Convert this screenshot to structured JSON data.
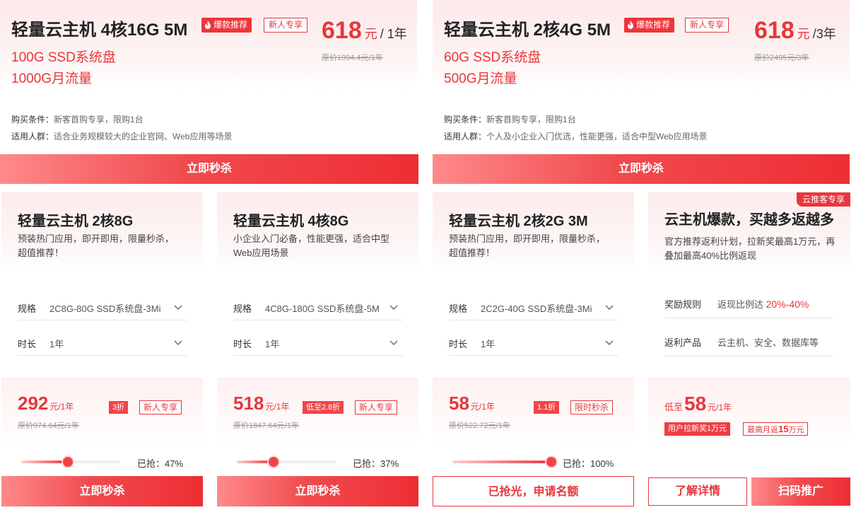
{
  "colors": {
    "accent": "#e8363c",
    "text": "#333333",
    "muted": "#999999"
  },
  "top_cards": [
    {
      "title": "轻量云主机 4核16G 5M",
      "hot_tag": "爆款推荐",
      "new_tag": "新人专享",
      "disk": "100G SSD系统盘",
      "traffic": "1000G月流量",
      "price": "618",
      "price_unit": "元",
      "price_period": "/ 1年",
      "original_price": "原价1994.4元/1年",
      "condition_label": "购买条件：",
      "condition_value": "新客首购专享，限购1台",
      "audience_label": "适用人群：",
      "audience_value": "适合业务规模较大的企业官网、Web应用等场景",
      "button": "立即秒杀"
    },
    {
      "title": "轻量云主机 2核4G 5M",
      "hot_tag": "爆款推荐",
      "new_tag": "新人专享",
      "disk": "60G SSD系统盘",
      "traffic": "500G月流量",
      "price": "618",
      "price_unit": "元",
      "price_period": "/3年",
      "original_price": "原价2495元/3年",
      "condition_label": "购买条件：",
      "condition_value": "新客首购专享，限购1台",
      "audience_label": "适用人群：",
      "audience_value": "个人及小企业入门优选，性能更强，适合中型Web应用场景",
      "button": "立即秒杀"
    }
  ],
  "small_cards": [
    {
      "title": "轻量云主机 2核8G",
      "desc": "预装热门应用，即开即用，限量秒杀，超值推荐！",
      "spec_label": "规格",
      "spec_value": "2C8G-80G SSD系统盘-3Mi",
      "duration_label": "时长",
      "duration_value": "1年",
      "price": "292",
      "price_unit": "元/1年",
      "discount": "3折",
      "tag": "新人专享",
      "original_price": "原价974.64元/1年",
      "grabbed_percent": 47,
      "grabbed_text": "已抢：47%",
      "button": "立即秒杀"
    },
    {
      "title": "轻量云主机 4核8G",
      "desc": "小企业入门必备，性能更强，适合中型Web应用场景",
      "spec_label": "规格",
      "spec_value": "4C8G-180G SSD系统盘-5M",
      "duration_label": "时长",
      "duration_value": "1年",
      "price": "518",
      "price_unit": "元/1年",
      "discount": "低至2.8折",
      "tag": "新人专享",
      "original_price": "原价1847.64元/1年",
      "grabbed_percent": 37,
      "grabbed_text": "已抢：37%",
      "button": "立即秒杀"
    },
    {
      "title": "轻量云主机 2核2G 3M",
      "desc": "预装热门应用，即开即用，限量秒杀，超值推荐！",
      "spec_label": "规格",
      "spec_value": "2C2G-40G SSD系统盘-3Mi",
      "duration_label": "时长",
      "duration_value": "1年",
      "price": "58",
      "price_unit": "元/1年",
      "discount": "1.1折",
      "tag": "限时秒杀",
      "original_price": "原价522.72元/1年",
      "grabbed_percent": 100,
      "grabbed_text": "已抢：100%",
      "button": "已抢光，申请名额"
    }
  ],
  "promo_card": {
    "corner_tag": "云推客专享",
    "title": "云主机爆款，买越多返越多",
    "desc": "官方推荐返利计划，拉新奖最高1万元，再叠加最高40%比例返现",
    "reward_label": "奖励规则",
    "reward_prefix": "返现比例达",
    "reward_highlight": "20%-40%",
    "product_label": "返利产品",
    "product_value": "云主机、安全、数据库等",
    "price_prefix": "低至",
    "price": "58",
    "price_unit": "元/1年",
    "tag1": "用户拉新奖1万元",
    "tag2_prefix": "最高月返",
    "tag2_amount": "15",
    "tag2_suffix": "万元",
    "detail_button": "了解详情",
    "qr_button": "扫码推广"
  }
}
